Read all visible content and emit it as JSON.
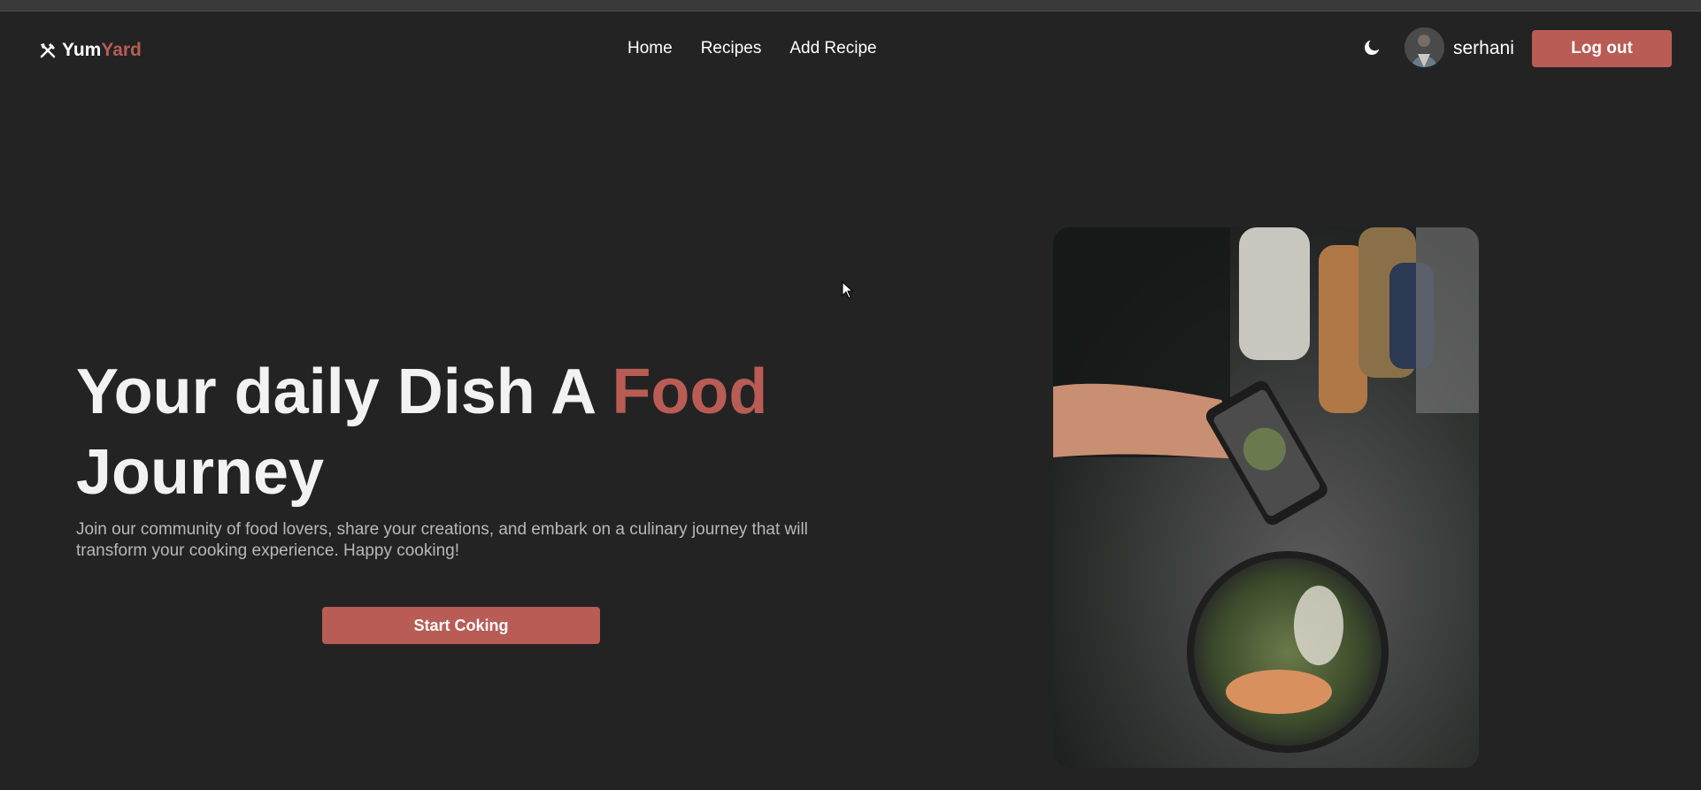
{
  "brand": {
    "name_part1": "Yum",
    "name_part2": "Yard",
    "icon": "utensils-icon",
    "accent_color": "#b85c55"
  },
  "nav": {
    "links": [
      {
        "label": "Home"
      },
      {
        "label": "Recipes"
      },
      {
        "label": "Add Recipe"
      }
    ]
  },
  "user": {
    "theme_toggle_icon": "moon-icon",
    "username": "serhani",
    "logout_label": "Log out"
  },
  "hero": {
    "title_part1": "Your daily Dish A ",
    "title_accent": "Food",
    "title_part2": "Journey",
    "description": "Join our community of food lovers, share your creations, and embark on a culinary journey that will transform your cooking experience. Happy cooking!",
    "cta_label": "Start Coking"
  },
  "colors": {
    "background": "#232323",
    "accent": "#b85c55",
    "text": "#ffffff",
    "muted_text": "#b8b8b8"
  }
}
